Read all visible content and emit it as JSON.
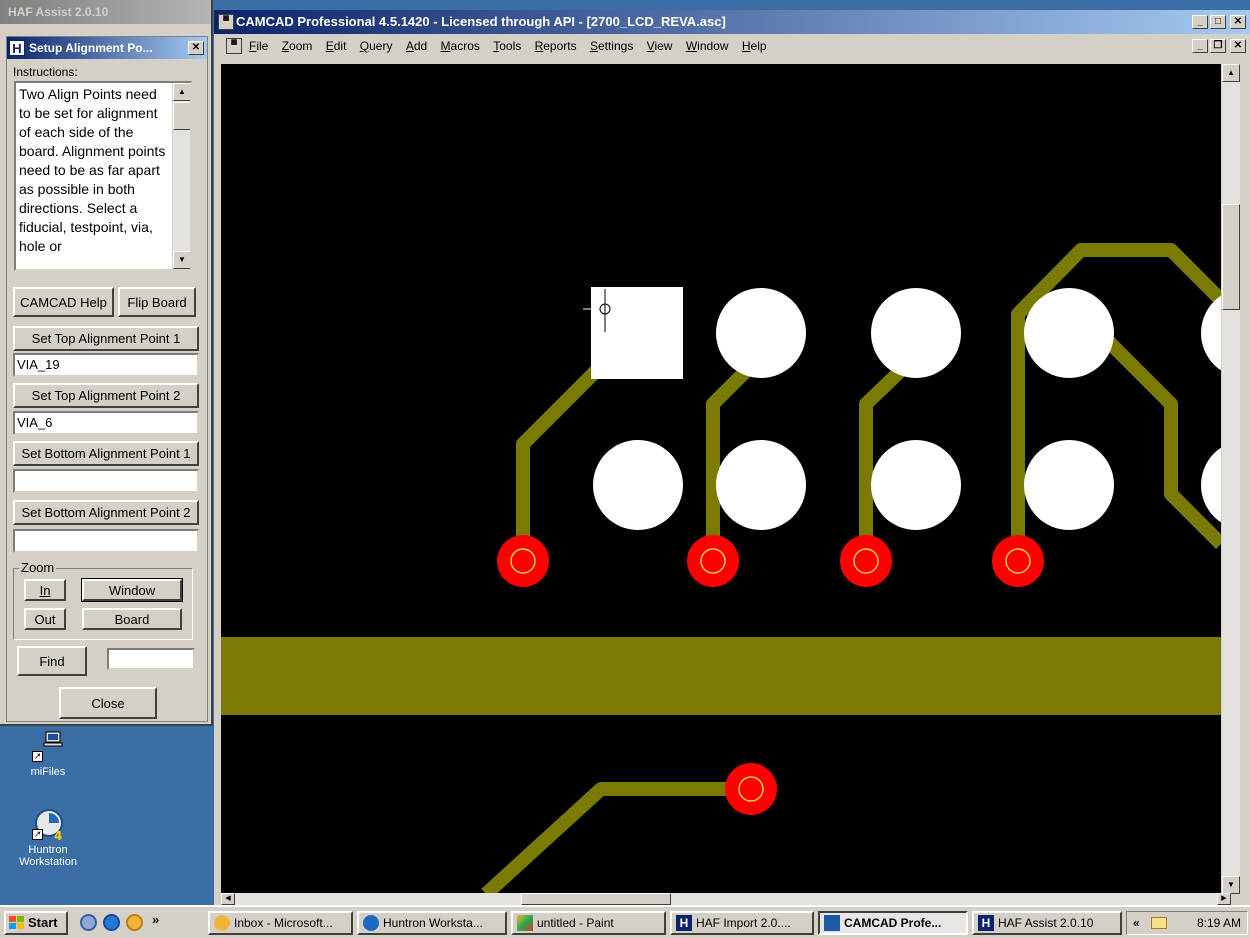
{
  "desktop": {
    "icons": [
      {
        "label": "miFiles"
      },
      {
        "label": "Huntron\nWorkstation"
      }
    ]
  },
  "haf_window": {
    "title": "HAF Assist 2.0.10"
  },
  "setup_dialog": {
    "title": "Setup Alignment Po...",
    "instructions_label": "Instructions:",
    "instructions_text": "Two Align Points need to be set for alignment of each side of the board. Alignment points need to be as far apart as possible in both directions. Select a fiducial, testpoint, via, hole or",
    "camcad_help_label": "CAMCAD Help",
    "flip_board_label": "Flip Board",
    "set_top_1_label": "Set Top Alignment Point 1",
    "top_1_value": "VIA_19",
    "set_top_2_label": "Set Top Alignment Point 2",
    "top_2_value": "VIA_6",
    "set_bottom_1_label": "Set Bottom Alignment Point 1",
    "bottom_1_value": "",
    "set_bottom_2_label": "Set Bottom Alignment Point 2",
    "bottom_2_value": "",
    "zoom_group_label": "Zoom",
    "zoom_in_label": "In",
    "zoom_window_label": "Window",
    "zoom_out_label": "Out",
    "zoom_board_label": "Board",
    "find_label": "Find",
    "find_value": "",
    "close_label": "Close"
  },
  "camcad_window": {
    "title": "CAMCAD Professional 4.5.1420 - Licensed through API - [2700_LCD_REVA.asc]",
    "menu": [
      "File",
      "Zoom",
      "Edit",
      "Query",
      "Add",
      "Macros",
      "Tools",
      "Reports",
      "Settings",
      "View",
      "Window",
      "Help"
    ],
    "colors": {
      "background": "#000000",
      "trace": "#7a7a05",
      "pad": "#ffffff",
      "via": "#ff0000",
      "via_ring": "#ffd24a"
    }
  },
  "taskbar": {
    "start_label": "Start",
    "tasks": [
      {
        "label": "Inbox - Microsoft..."
      },
      {
        "label": "Huntron Worksta..."
      },
      {
        "label": "untitled - Paint"
      },
      {
        "label": "HAF Import 2.0...."
      },
      {
        "label": "CAMCAD Profe..."
      },
      {
        "label": "HAF Assist 2.0.10"
      }
    ],
    "clock": "8:19 AM",
    "chevron": "»",
    "tray_chevron": "«"
  }
}
